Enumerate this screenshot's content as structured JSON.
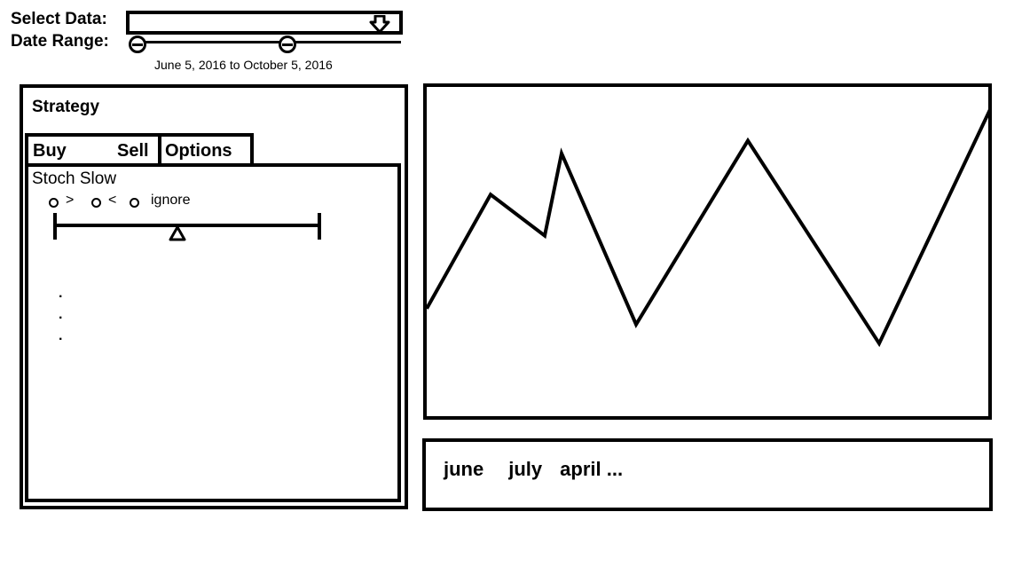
{
  "header": {
    "select_label": "Select Data:",
    "range_label": "Date Range:",
    "range_text": "June 5, 2016 to October 5, 2016",
    "select_value": ""
  },
  "strategy": {
    "title": "Strategy",
    "tabs": {
      "buy": "Buy",
      "sell": "Sell",
      "options": "Options"
    },
    "indicator": "Stoch Slow",
    "conditions": [
      ">",
      "<",
      "ignore"
    ],
    "more": [
      "·",
      "·",
      "·"
    ]
  },
  "chart_data": {
    "type": "line",
    "series": [
      {
        "values": [
          0.32,
          0.68,
          0.55,
          0.81,
          0.27,
          0.85,
          0.21,
          0.96
        ]
      }
    ],
    "color": "#000000"
  },
  "timeline": {
    "months": [
      "june",
      "july",
      "april ..."
    ]
  }
}
